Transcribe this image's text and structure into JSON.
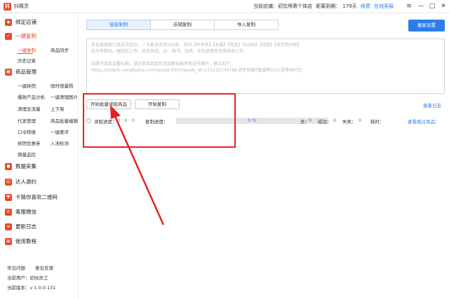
{
  "app": {
    "title": "抖精灵",
    "logo_letter": "抖"
  },
  "header": {
    "store_label": "当前店铺：初饮甩寄个体店",
    "expiry_label": "距离到期：",
    "expiry_days": "179天",
    "renew": "续费",
    "service": "在线客服"
  },
  "window_controls": {
    "menu": "≡",
    "minimize": "—",
    "maximize": "□",
    "close": "✕"
  },
  "sidebar": {
    "bind_store": "绑定店铺",
    "one_click_copy": "一键复制",
    "copy_items": {
      "one_click": "一键复制",
      "sync": "商品同步",
      "history": "历史记录"
    },
    "goods_manage": "商品管理",
    "goods_items": [
      "一键拼团",
      "限时限量购",
      "爆款产品分析",
      "一键清理图片",
      "清理无流量",
      "上下架",
      "代发管理",
      "商品批量编辑",
      "口令转换",
      "一键差评",
      "拼团优惠券",
      "入池检测",
      "销量监控"
    ],
    "data_collect": "数据采集",
    "invite": "达人邀约",
    "qrcode": "卡猜你喜欢二维码",
    "wechat": "客服微信",
    "update_log": "更新日志",
    "tutorial": "使用教程"
  },
  "footer": {
    "faq": "常见问题",
    "feedback": "意见反馈",
    "user": "当前用户：初纹员工",
    "version": "当前版本：v 1.0.0.131"
  },
  "tabs": [
    "链接复制",
    "店铺复制",
    "导入复制"
  ],
  "move_button": "搬家设置",
  "textarea_lines": [
    "多条链接换行或逗号区分，一次最多支持500条，支持【拼多多】【天猫】【淘宝】【1688】【抖音】【淘宝特价版】",
    "支持考数码、跟团店上传。支持食品、3c、图书、玩具、化妆品等有资质类目上传。",
    "",
    "如需为商品设置标题，请在商品链接后追加新标题并用逗号隔开，格式如下：",
    "https://mobile.yangkeduo.com/goods.html?goods_id=231115144766,男生短袖T恤潮牌2021夏季纯打包"
  ],
  "buttons": {
    "batch_read": "开始批量读取商品",
    "start_copy": "开始复制"
  },
  "view_log": "查看日志",
  "status": {
    "read_progress_label": "读取进度：",
    "read_progress_value": "0 : 0 : 0",
    "copy_progress_label": "复制进度：",
    "copy_progress_value": "0 %",
    "copy_progress_fraction": 0,
    "total_label": "总：",
    "total_value": "0",
    "success_label": "成功：",
    "success_value": "0",
    "fail_label": "失败：",
    "fail_value": "0",
    "time_label": "耗时：",
    "time_value": "",
    "view_skipped": "查看跳过商品："
  },
  "colors": {
    "accent": "#e8492a",
    "primary": "#2b7de9",
    "annotation": "#e32222"
  }
}
